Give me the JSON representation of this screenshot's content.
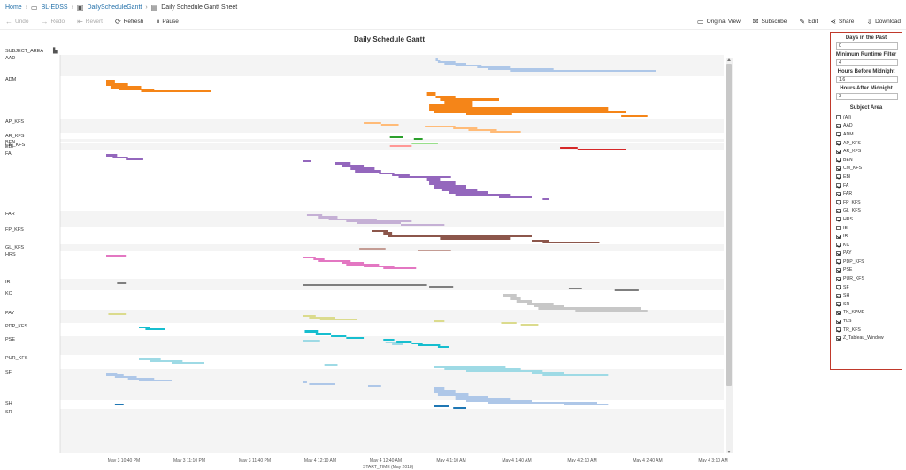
{
  "breadcrumb": {
    "home": "Home",
    "project": "BL-EDSS",
    "workbook": "DailyScheduleGantt",
    "sheet": "Daily Schedule Gantt Sheet"
  },
  "toolbar": {
    "undo": "Undo",
    "redo": "Redo",
    "revert": "Revert",
    "refresh": "Refresh",
    "pause": "Pause",
    "original_view": "Original View",
    "subscribe": "Subscribe",
    "edit": "Edit",
    "share": "Share",
    "download": "Download"
  },
  "panel": {
    "days_label": "Days in the Past",
    "days_value": "0",
    "runtime_label": "Minimum Runtime Filter",
    "runtime_value": "4",
    "before_label": "Hours Before Midnight",
    "before_value": "1.6",
    "after_label": "Hours After Midnight",
    "after_value": "3",
    "subject_label": "Subject Area",
    "subjects": [
      {
        "name": "(All)",
        "checked": false
      },
      {
        "name": "AAD",
        "checked": true
      },
      {
        "name": "ADM",
        "checked": true
      },
      {
        "name": "AP_KFS",
        "checked": true
      },
      {
        "name": "AR_KFS",
        "checked": true
      },
      {
        "name": "BEN",
        "checked": true
      },
      {
        "name": "CM_KFS",
        "checked": true
      },
      {
        "name": "EBI",
        "checked": true
      },
      {
        "name": "FA",
        "checked": true
      },
      {
        "name": "FAR",
        "checked": true
      },
      {
        "name": "FP_KFS",
        "checked": true
      },
      {
        "name": "GL_KFS",
        "checked": true
      },
      {
        "name": "HRS",
        "checked": true
      },
      {
        "name": "IE",
        "checked": false
      },
      {
        "name": "IR",
        "checked": true
      },
      {
        "name": "KC",
        "checked": true
      },
      {
        "name": "PAY",
        "checked": true
      },
      {
        "name": "PDP_KFS",
        "checked": true
      },
      {
        "name": "PSE",
        "checked": true
      },
      {
        "name": "PUR_KFS",
        "checked": true
      },
      {
        "name": "SF",
        "checked": true
      },
      {
        "name": "SH",
        "checked": true
      },
      {
        "name": "SR",
        "checked": true
      },
      {
        "name": "TK_KPME",
        "checked": true
      },
      {
        "name": "TLS",
        "checked": true
      },
      {
        "name": "TR_KFS",
        "checked": true
      },
      {
        "name": "Z_Tableau_Window",
        "checked": true
      }
    ]
  },
  "chart_data": {
    "type": "gantt",
    "title": "Daily Schedule Gantt",
    "row_header": "SUBJECT_AREA",
    "xlabel": "START_TIME (May 2018)",
    "x_ticks": [
      "May 3 10:40 PM",
      "May 3 11:10 PM",
      "May 3 11:40 PM",
      "May 4 12:10 AM",
      "May 4 12:40 AM",
      "May 4 1:10 AM",
      "May 4 1:40 AM",
      "May 4 2:10 AM",
      "May 4 2:40 AM",
      "May 4 3:10 AM"
    ],
    "x_tick_minutes": [
      0,
      30,
      60,
      90,
      120,
      150,
      180,
      210,
      240,
      270
    ],
    "rows": [
      {
        "name": "AAD",
        "color": "#aec7e8",
        "bars": [
          [
            151,
            152,
            2
          ],
          [
            151,
            153,
            1
          ],
          [
            152,
            160,
            2
          ],
          [
            155,
            165,
            2
          ],
          [
            160,
            172,
            2
          ],
          [
            170,
            185,
            2
          ],
          [
            175,
            205,
            2
          ],
          [
            185,
            252,
            2
          ]
        ]
      },
      {
        "name": "ADM",
        "color": "#f58518",
        "bars": [
          [
            0,
            4,
            4
          ],
          [
            0,
            10,
            3
          ],
          [
            2,
            16,
            3
          ],
          [
            6,
            22,
            2
          ],
          [
            16,
            48,
            2
          ],
          [
            147,
            151,
            4
          ],
          [
            151,
            160,
            3
          ],
          [
            153,
            180,
            3
          ],
          [
            155,
            168,
            3
          ],
          [
            148,
            168,
            4
          ],
          [
            148,
            230,
            4
          ],
          [
            150,
            238,
            3
          ],
          [
            165,
            186,
            2
          ],
          [
            236,
            248,
            2
          ]
        ]
      },
      {
        "name": "AP_KFS",
        "color": "#ffbb78",
        "bars": [
          [
            118,
            126,
            2
          ],
          [
            126,
            134,
            2
          ],
          [
            146,
            160,
            2
          ],
          [
            159,
            170,
            2
          ],
          [
            166,
            179,
            2
          ],
          [
            176,
            190,
            2
          ]
        ]
      },
      {
        "name": "AR_KFS",
        "color": "#2ca02c",
        "bars": [
          [
            130,
            136,
            2
          ],
          [
            141,
            145,
            2
          ]
        ]
      },
      {
        "name": "BEN",
        "color": "#98df8a",
        "bars": [
          [
            140,
            152,
            2
          ]
        ]
      },
      {
        "name": "CM_KFS",
        "color": "#ff9896",
        "bars": [
          [
            130,
            140,
            2
          ]
        ]
      },
      {
        "name": "EBI",
        "color": "#d62728",
        "bars": [
          [
            208,
            216,
            2
          ],
          [
            216,
            238,
            2
          ]
        ]
      },
      {
        "name": "FA",
        "color": "#9467bd",
        "bars": [
          [
            0,
            5,
            3
          ],
          [
            3,
            10,
            2
          ],
          [
            9,
            17,
            2
          ],
          [
            90,
            94,
            2
          ],
          [
            105,
            112,
            3
          ],
          [
            108,
            118,
            3
          ],
          [
            112,
            123,
            3
          ],
          [
            114,
            126,
            3
          ],
          [
            125,
            132,
            2
          ],
          [
            131,
            139,
            2
          ],
          [
            134,
            158,
            2
          ],
          [
            147,
            153,
            4
          ],
          [
            148,
            160,
            4
          ],
          [
            150,
            165,
            4
          ],
          [
            154,
            170,
            3
          ],
          [
            157,
            175,
            3
          ],
          [
            160,
            185,
            3
          ],
          [
            180,
            195,
            2
          ],
          [
            200,
            203,
            2
          ]
        ]
      },
      {
        "name": "FAR",
        "color": "#c5b0d5",
        "bars": [
          [
            92,
            99,
            2
          ],
          [
            97,
            106,
            3
          ],
          [
            102,
            124,
            2
          ],
          [
            110,
            140,
            2
          ],
          [
            115,
            135,
            2
          ],
          [
            135,
            155,
            2
          ]
        ]
      },
      {
        "name": "FP_KFS",
        "color": "#8c564b",
        "bars": [
          [
            122,
            129,
            2
          ],
          [
            127,
            131,
            3
          ],
          [
            129,
            195,
            3
          ],
          [
            153,
            185,
            3
          ],
          [
            195,
            203,
            2
          ],
          [
            200,
            226,
            2
          ]
        ]
      },
      {
        "name": "GL_KFS",
        "color": "#c49c94",
        "bars": [
          [
            116,
            128,
            2
          ],
          [
            143,
            158,
            2
          ]
        ]
      },
      {
        "name": "HRS",
        "color": "#e377c2",
        "bars": [
          [
            0,
            9,
            2
          ],
          [
            90,
            96,
            2
          ],
          [
            95,
            100,
            2
          ],
          [
            97,
            112,
            2
          ],
          [
            108,
            118,
            2
          ],
          [
            110,
            125,
            2
          ],
          [
            118,
            132,
            2
          ],
          [
            127,
            142,
            2
          ]
        ]
      },
      {
        "name": "IR",
        "color": "#7f7f7f",
        "bars": [
          [
            5,
            9,
            2
          ],
          [
            90,
            147,
            2
          ],
          [
            148,
            159,
            2
          ],
          [
            212,
            218,
            2
          ],
          [
            233,
            244,
            2
          ]
        ]
      },
      {
        "name": "KC",
        "color": "#c7c7c7",
        "bars": [
          [
            182,
            188,
            4
          ],
          [
            185,
            190,
            3
          ],
          [
            188,
            195,
            3
          ],
          [
            193,
            205,
            3
          ],
          [
            196,
            210,
            2
          ],
          [
            198,
            245,
            3
          ],
          [
            215,
            248,
            3
          ]
        ]
      },
      {
        "name": "PAY",
        "color": "#dbdb8d",
        "bars": [
          [
            1,
            9,
            2
          ],
          [
            90,
            96,
            2
          ],
          [
            93,
            105,
            2
          ],
          [
            98,
            115,
            2
          ],
          [
            150,
            155,
            2
          ],
          [
            181,
            188,
            2
          ],
          [
            190,
            198,
            2
          ]
        ]
      },
      {
        "name": "PDP_KFS",
        "color": "#17becf",
        "bars": [
          [
            15,
            20,
            2
          ],
          [
            18,
            27,
            2
          ],
          [
            91,
            97,
            3
          ],
          [
            96,
            103,
            3
          ],
          [
            103,
            110,
            2
          ],
          [
            110,
            118,
            2
          ],
          [
            127,
            132,
            2
          ],
          [
            133,
            140,
            2
          ],
          [
            140,
            145,
            2
          ],
          [
            143,
            153,
            2
          ],
          [
            152,
            157,
            2
          ]
        ]
      },
      {
        "name": "PSE",
        "color": "#9edae5",
        "bars": [
          [
            90,
            98,
            2
          ],
          [
            128,
            133,
            2
          ],
          [
            131,
            136,
            2
          ]
        ]
      },
      {
        "name": "PUR_KFS",
        "color": "#9edae5",
        "bars": [
          [
            15,
            25,
            2
          ],
          [
            20,
            35,
            2
          ],
          [
            30,
            45,
            2
          ],
          [
            100,
            106,
            2
          ],
          [
            150,
            183,
            3
          ],
          [
            155,
            190,
            2
          ],
          [
            165,
            200,
            2
          ],
          [
            195,
            210,
            3
          ],
          [
            200,
            230,
            2
          ]
        ]
      },
      {
        "name": "SF",
        "color": "#aec7e8",
        "bars": [
          [
            0,
            5,
            2
          ],
          [
            0,
            8,
            2
          ],
          [
            4,
            14,
            2
          ],
          [
            10,
            22,
            2
          ],
          [
            15,
            30,
            2
          ],
          [
            90,
            92,
            2
          ],
          [
            93,
            105,
            2
          ],
          [
            120,
            126,
            2
          ],
          [
            150,
            155,
            4
          ],
          [
            150,
            160,
            3
          ],
          [
            152,
            166,
            3
          ],
          [
            160,
            175,
            3
          ],
          [
            160,
            185,
            2
          ],
          [
            165,
            195,
            2
          ],
          [
            175,
            225,
            2
          ],
          [
            210,
            230,
            2
          ]
        ]
      },
      {
        "name": "SH",
        "color": "#1f77b4",
        "bars": [
          [
            4,
            8,
            2
          ],
          [
            150,
            157,
            2
          ],
          [
            159,
            165,
            2
          ]
        ]
      },
      {
        "name": "SR",
        "color": "#aec7e8",
        "bars": []
      }
    ]
  }
}
